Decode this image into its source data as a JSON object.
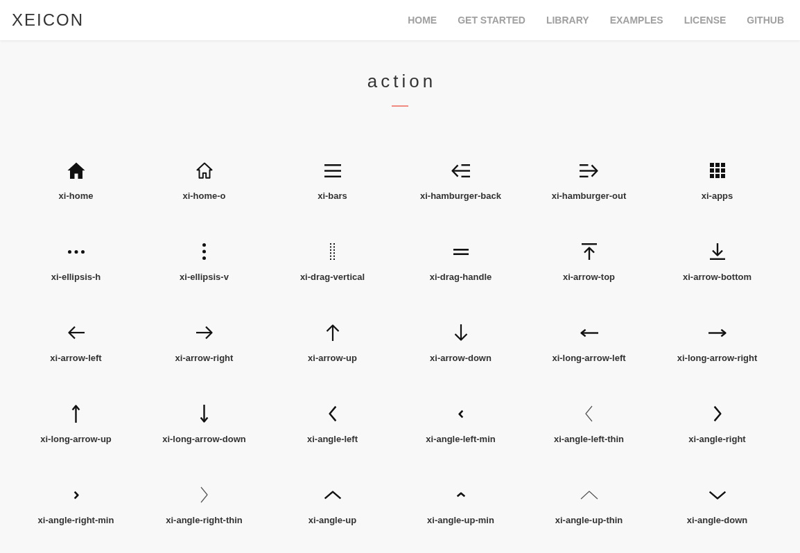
{
  "header": {
    "logo": "XEICON",
    "nav": [
      "HOME",
      "GET STARTED",
      "LIBRARY",
      "EXAMPLES",
      "LICENSE",
      "GITHUB"
    ]
  },
  "section": {
    "title": "action",
    "icons": [
      "xi-home",
      "xi-home-o",
      "xi-bars",
      "xi-hamburger-back",
      "xi-hamburger-out",
      "xi-apps",
      "xi-ellipsis-h",
      "xi-ellipsis-v",
      "xi-drag-vertical",
      "xi-drag-handle",
      "xi-arrow-top",
      "xi-arrow-bottom",
      "xi-arrow-left",
      "xi-arrow-right",
      "xi-arrow-up",
      "xi-arrow-down",
      "xi-long-arrow-left",
      "xi-long-arrow-right",
      "xi-long-arrow-up",
      "xi-long-arrow-down",
      "xi-angle-left",
      "xi-angle-left-min",
      "xi-angle-left-thin",
      "xi-angle-right",
      "xi-angle-right-min",
      "xi-angle-right-thin",
      "xi-angle-up",
      "xi-angle-up-min",
      "xi-angle-up-thin",
      "xi-angle-down"
    ]
  }
}
